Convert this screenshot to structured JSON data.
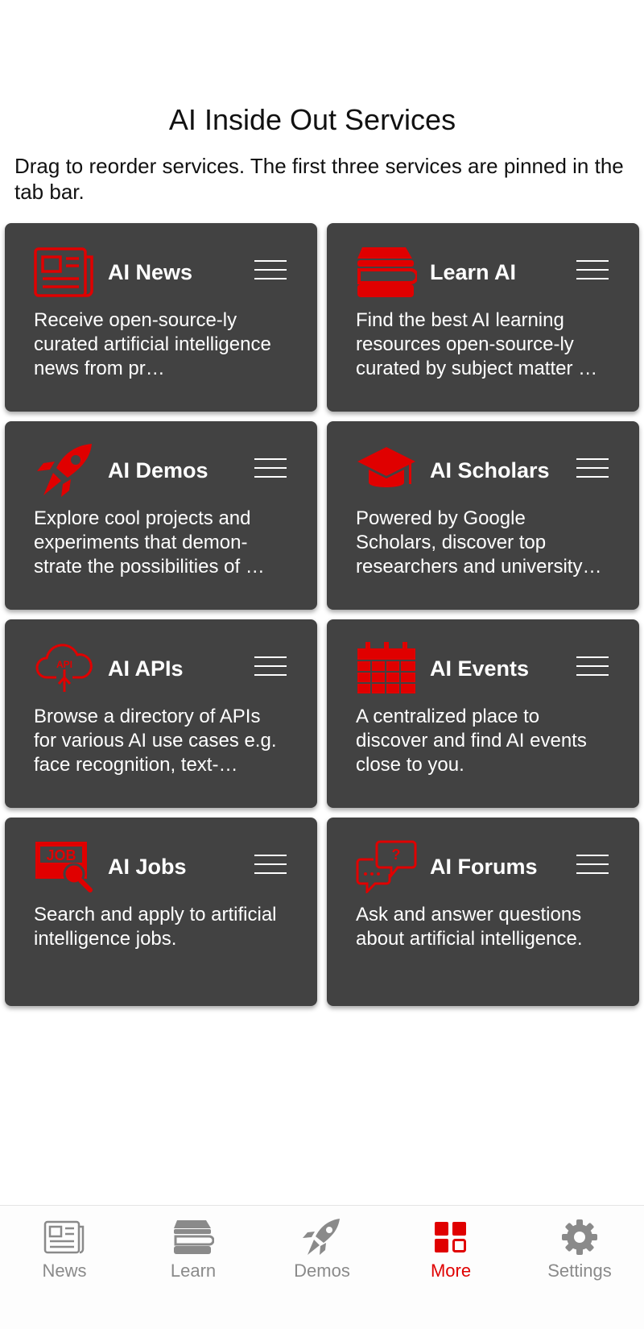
{
  "header": {
    "title": "AI Inside Out Services",
    "subtitle": "Drag to reorder services. The first three services are pinned in the tab bar."
  },
  "colors": {
    "accent": "#e00000",
    "card_bg": "#424242",
    "inactive_tab": "#8a8a8a"
  },
  "services": [
    {
      "title": "AI News",
      "icon": "newspaper-icon",
      "description": "Receive open-source-ly curated artificial intelligence news from pr…"
    },
    {
      "title": "Learn AI",
      "icon": "books-icon",
      "description": "Find the best AI learning resources open-source-ly curated by subject matter …"
    },
    {
      "title": "AI Demos",
      "icon": "rocket-icon",
      "description": "Explore cool projects and experiments that demon-strate the possibilities of …"
    },
    {
      "title": "AI Scholars",
      "icon": "graduation-cap-icon",
      "description": "Powered by Google Scholars, discover top researchers and university…"
    },
    {
      "title": "AI APIs",
      "icon": "api-cloud-icon",
      "description": "Browse a directory of APIs for various AI use cases e.g. face recognition, text-…"
    },
    {
      "title": "AI Events",
      "icon": "calendar-icon",
      "description": "A centralized place to discover and find AI events close to you."
    },
    {
      "title": "AI Jobs",
      "icon": "job-search-icon",
      "description": "Search and apply to artificial intelligence jobs."
    },
    {
      "title": "AI Forums",
      "icon": "forum-icon",
      "description": "Ask and answer questions about artificial intelligence."
    }
  ],
  "tabbar": {
    "items": [
      {
        "label": "News",
        "icon": "newspaper-icon",
        "active": false
      },
      {
        "label": "Learn",
        "icon": "books-icon",
        "active": false
      },
      {
        "label": "Demos",
        "icon": "rocket-icon",
        "active": false
      },
      {
        "label": "More",
        "icon": "grid-icon",
        "active": true
      },
      {
        "label": "Settings",
        "icon": "gear-icon",
        "active": false
      }
    ]
  }
}
